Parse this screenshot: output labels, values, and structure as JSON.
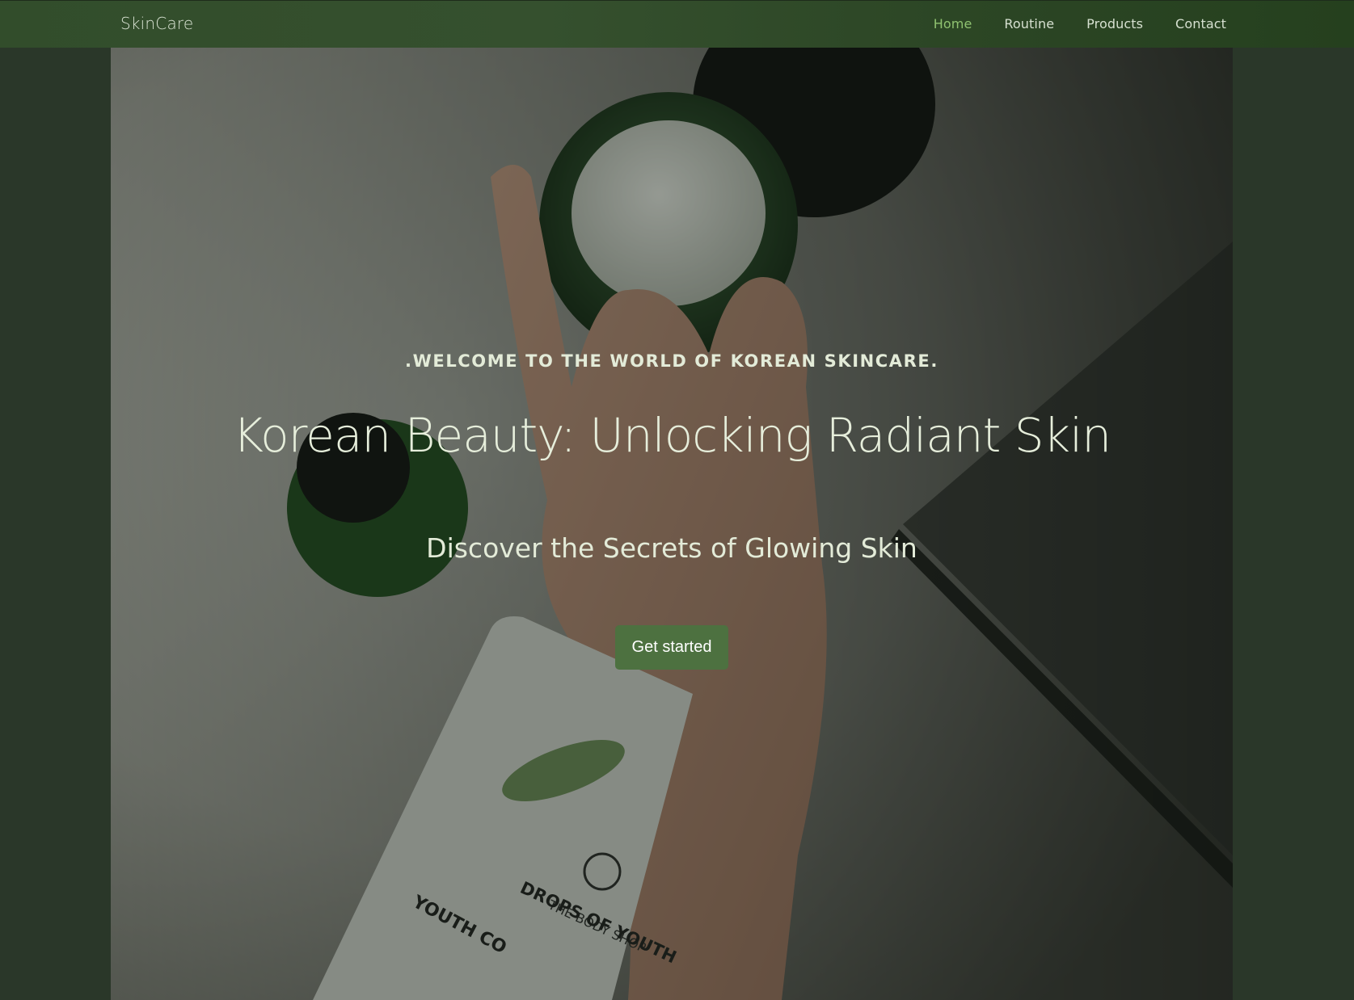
{
  "nav": {
    "brand": "SkinCare",
    "links": [
      {
        "label": "Home",
        "active": true
      },
      {
        "label": "Routine",
        "active": false
      },
      {
        "label": "Products",
        "active": false
      },
      {
        "label": "Contact",
        "active": false
      }
    ]
  },
  "hero": {
    "eyebrow": ".WELCOME TO THE WORLD OF KOREAN SKINCARE.",
    "headline": "Korean Beauty: Unlocking Radiant Skin",
    "subheadline": "Discover the Secrets of Glowing Skin",
    "cta_label": "Get started",
    "image_text": {
      "brand_on_pack": "THE BODY SHOP",
      "product_line": "DROPS OF YOUTH",
      "pack_side": "YOUTH CO"
    }
  },
  "colors": {
    "page_background": "#2a3729",
    "navbar": "#324d2b",
    "nav_active": "#8fc270",
    "cta": "#4d7140",
    "hero_text": "#e3ebd8"
  }
}
